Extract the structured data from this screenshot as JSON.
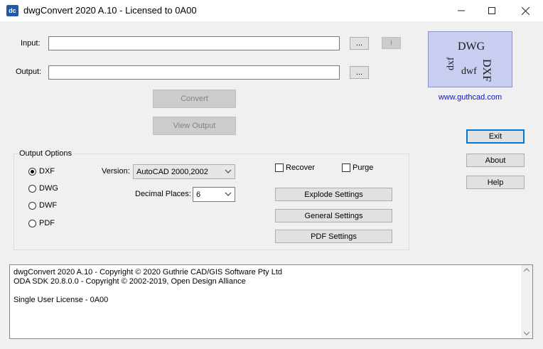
{
  "window": {
    "title": "dwgConvert 2020 A.10 - Licensed to 0A00",
    "icon_text": "dc",
    "controls": [
      "minimize-icon",
      "maximize-icon",
      "close-icon"
    ]
  },
  "input": {
    "label": "Input:",
    "value": "",
    "browse_label": "...",
    "info_label": "i"
  },
  "output": {
    "label": "Output:",
    "value": "",
    "browse_label": "..."
  },
  "actions": {
    "convert_label": "Convert",
    "view_output_label": "View Output"
  },
  "logo": {
    "dwg": "DWG",
    "dxf": "DXF",
    "dxf_small": "dxf",
    "dwf": "dwf",
    "url": "www.guthcad.com"
  },
  "side_buttons": {
    "exit": "Exit",
    "about": "About",
    "help": "Help"
  },
  "options": {
    "title": "Output Options",
    "formats": [
      {
        "label": "DXF",
        "selected": true
      },
      {
        "label": "DWG",
        "selected": false
      },
      {
        "label": "DWF",
        "selected": false
      },
      {
        "label": "PDF",
        "selected": false
      }
    ],
    "version_label": "Version:",
    "version_value": "AutoCAD 2000,2002",
    "decimal_label": "Decimal Places:",
    "decimal_value": "6",
    "recover_label": "Recover",
    "recover_checked": false,
    "purge_label": "Purge",
    "purge_checked": false,
    "explode_label": "Explode Settings",
    "general_label": "General Settings",
    "pdf_label": "PDF Settings"
  },
  "log": {
    "lines": [
      "dwgConvert 2020 A.10 - Copyright © 2020 Guthrie CAD/GIS Software Pty Ltd",
      "ODA SDK 20.8.0.0 - Copyright © 2002-2019, Open Design Alliance",
      "",
      "Single User License - 0A00"
    ]
  },
  "colors": {
    "accent": "#0078d7",
    "logo_bg": "#c9cdf0",
    "link": "#1010c8",
    "dialog_bg": "#f0f0f0"
  }
}
